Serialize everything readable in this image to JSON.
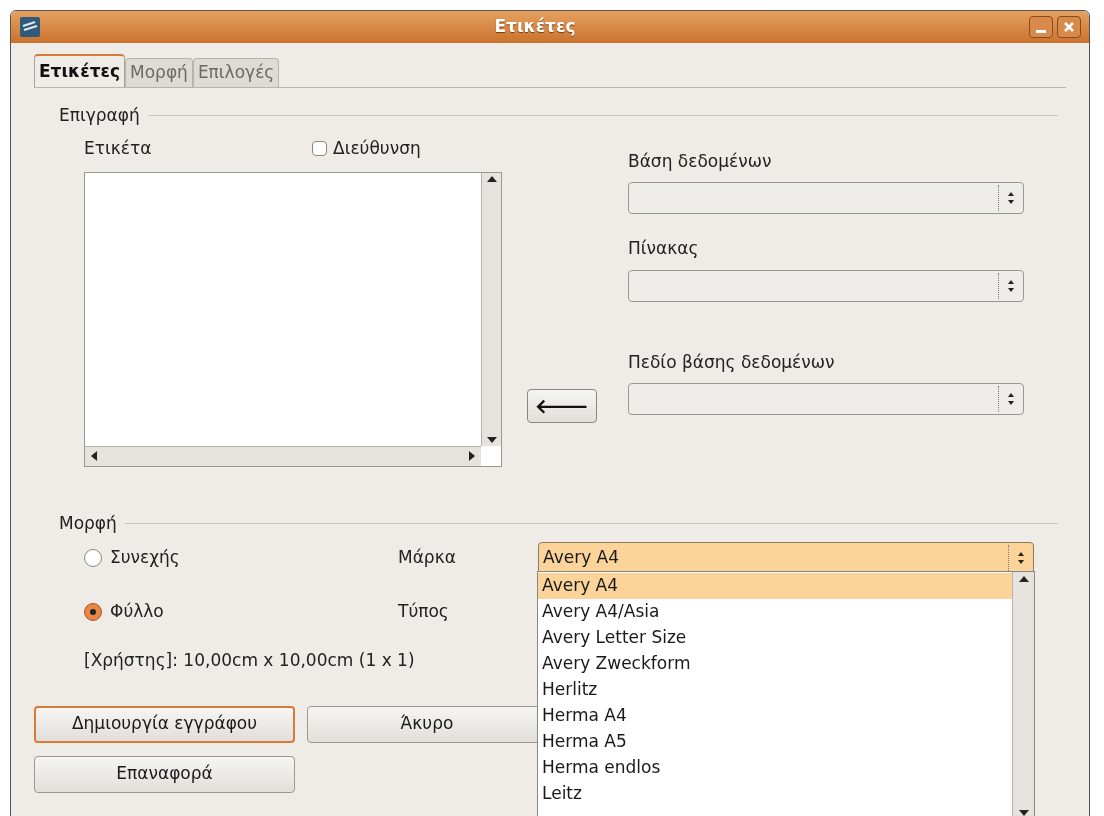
{
  "window": {
    "title": "Ετικέτες"
  },
  "tabs": [
    {
      "label": "Ετικέτες",
      "selected": true
    },
    {
      "label": "Μορφή",
      "selected": false
    },
    {
      "label": "Επιλογές",
      "selected": false
    }
  ],
  "inscription": {
    "title": "Επιγραφή",
    "label_text": "Ετικέτα",
    "address": {
      "label": "Διεύθυνση",
      "checked": false
    },
    "database": {
      "label": "Βάση δεδομένων"
    },
    "table": {
      "label": "Πίνακας"
    },
    "field": {
      "label": "Πεδίο βάσης δεδομένων"
    },
    "insert_arrow": "🡐"
  },
  "format": {
    "title": "Μορφή",
    "options": [
      {
        "label": "Συνεχής",
        "selected": false
      },
      {
        "label": "Φύλλο",
        "selected": true
      }
    ],
    "brand": {
      "label": "Μάρκα",
      "value": "Avery A4"
    },
    "type": {
      "label": "Τύπος"
    },
    "info": "[Χρήστης]: 10,00cm x 10,00cm (1 x 1)",
    "brand_list": [
      {
        "label": "Avery A4",
        "selected": true
      },
      {
        "label": "Avery A4/Asia",
        "selected": false
      },
      {
        "label": "Avery Letter Size",
        "selected": false
      },
      {
        "label": "Avery Zweckform",
        "selected": false
      },
      {
        "label": "Herlitz",
        "selected": false
      },
      {
        "label": "Herma A4",
        "selected": false
      },
      {
        "label": "Herma A5",
        "selected": false
      },
      {
        "label": "Herma endlos",
        "selected": false
      },
      {
        "label": "Leitz",
        "selected": false
      }
    ]
  },
  "buttons": [
    {
      "label": "Δημιουργία εγγράφου",
      "kind": "default"
    },
    {
      "label": "Άκυρο",
      "kind": "normal"
    },
    {
      "label": "Επαναφορά",
      "kind": "normal"
    }
  ]
}
